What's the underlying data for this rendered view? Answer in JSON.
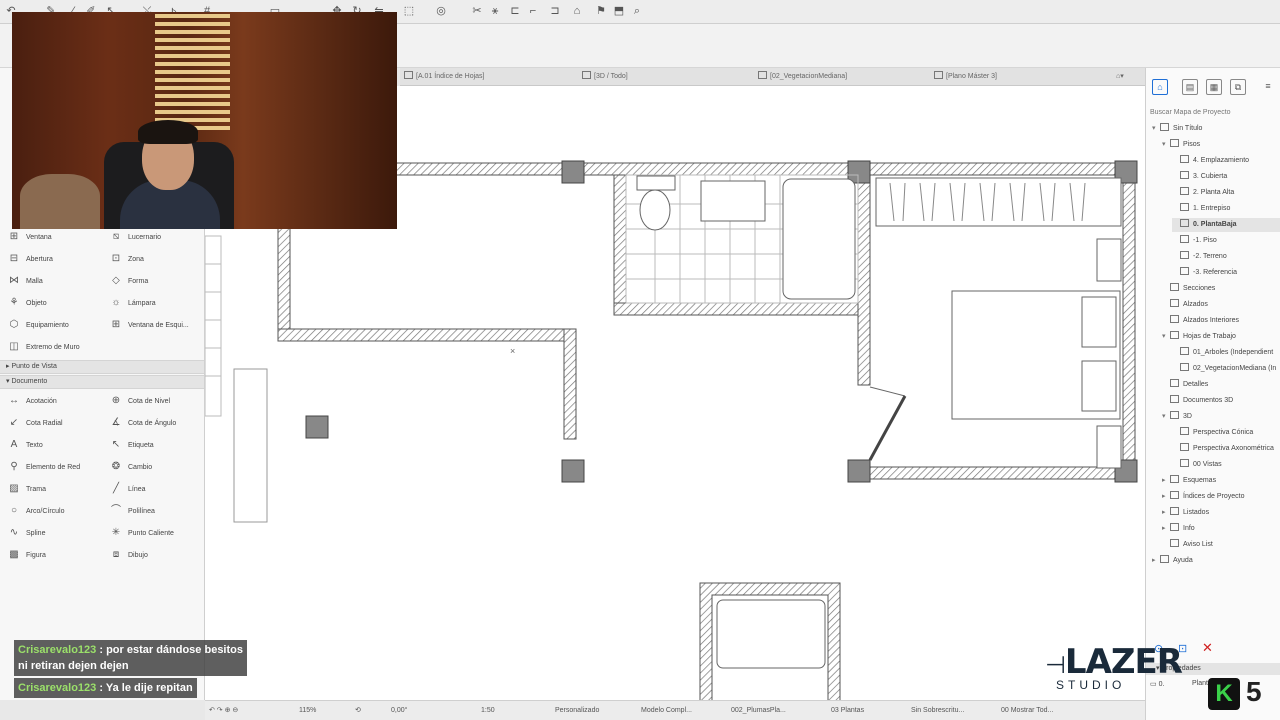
{
  "tabs": [
    {
      "label": "[A.01 Índice de Hojas]"
    },
    {
      "label": "[3D / Todo]"
    },
    {
      "label": "[02_VegetacionMediana]"
    },
    {
      "label": "[Plano Máster 3]"
    }
  ],
  "toolbox": {
    "tools_top": [
      {
        "label": "Ventana",
        "icon": "window-icon"
      },
      {
        "label": "Lucernario",
        "icon": "skylight-icon"
      },
      {
        "label": "Abertura",
        "icon": "opening-icon"
      },
      {
        "label": "Zona",
        "icon": "zone-icon"
      },
      {
        "label": "Malla",
        "icon": "mesh-icon"
      },
      {
        "label": "Forma",
        "icon": "morph-icon"
      },
      {
        "label": "Objeto",
        "icon": "object-icon"
      },
      {
        "label": "Lámpara",
        "icon": "lamp-icon"
      },
      {
        "label": "Equipamiento",
        "icon": "equipment-icon"
      },
      {
        "label": "Ventana de Esqui...",
        "icon": "corner-window-icon"
      },
      {
        "label": "Extremo de Muro",
        "icon": "wall-end-icon"
      }
    ],
    "section_view": "Punto de Vista",
    "section_doc": "Documento",
    "tools_doc": [
      {
        "label": "Acotación",
        "icon": "dimension-icon"
      },
      {
        "label": "Cota de Nivel",
        "icon": "level-dimension-icon"
      },
      {
        "label": "Cota Radial",
        "icon": "radial-dimension-icon"
      },
      {
        "label": "Cota de Ángulo",
        "icon": "angle-dimension-icon"
      },
      {
        "label": "Texto",
        "icon": "text-icon"
      },
      {
        "label": "Etiqueta",
        "icon": "label-icon"
      },
      {
        "label": "Elemento de Red",
        "icon": "grid-element-icon"
      },
      {
        "label": "Cambio",
        "icon": "change-icon"
      },
      {
        "label": "Trama",
        "icon": "fill-icon"
      },
      {
        "label": "Línea",
        "icon": "line-icon"
      },
      {
        "label": "Arco/Círculo",
        "icon": "arc-circle-icon"
      },
      {
        "label": "Polilínea",
        "icon": "polyline-icon"
      },
      {
        "label": "Spline",
        "icon": "spline-icon"
      },
      {
        "label": "Punto Caliente",
        "icon": "hotspot-icon"
      },
      {
        "label": "Figura",
        "icon": "figure-icon"
      },
      {
        "label": "Dibujo",
        "icon": "drawing-icon"
      }
    ]
  },
  "navigator": {
    "search_placeholder": "Buscar Mapa de Proyecto",
    "items": [
      {
        "label": "Sin Título",
        "level": 0,
        "caret": "v"
      },
      {
        "label": "Pisos",
        "level": 1,
        "caret": "v"
      },
      {
        "label": "4. Emplazamiento",
        "level": 2,
        "caret": ""
      },
      {
        "label": "3. Cubierta",
        "level": 2,
        "caret": ""
      },
      {
        "label": "2. Planta Alta",
        "level": 2,
        "caret": ""
      },
      {
        "label": "1. Entrepiso",
        "level": 2,
        "caret": ""
      },
      {
        "label": "0. PlantaBaja",
        "level": 2,
        "caret": "",
        "selected": true
      },
      {
        "label": "-1. Piso",
        "level": 2,
        "caret": ""
      },
      {
        "label": "-2. Terreno",
        "level": 2,
        "caret": ""
      },
      {
        "label": "-3. Referencia",
        "level": 2,
        "caret": ""
      },
      {
        "label": "Secciones",
        "level": 1,
        "caret": ""
      },
      {
        "label": "Alzados",
        "level": 1,
        "caret": ""
      },
      {
        "label": "Alzados Interiores",
        "level": 1,
        "caret": ""
      },
      {
        "label": "Hojas de Trabajo",
        "level": 1,
        "caret": "v"
      },
      {
        "label": "01_Arboles (Independient",
        "level": 2,
        "caret": ""
      },
      {
        "label": "02_VegetacionMediana (In",
        "level": 2,
        "caret": ""
      },
      {
        "label": "Detalles",
        "level": 1,
        "caret": ""
      },
      {
        "label": "Documentos 3D",
        "level": 1,
        "caret": ""
      },
      {
        "label": "3D",
        "level": 1,
        "caret": "v"
      },
      {
        "label": "Perspectiva Cónica",
        "level": 2,
        "caret": ""
      },
      {
        "label": "Perspectiva Axonométrica",
        "level": 2,
        "caret": ""
      },
      {
        "label": "00 Vistas",
        "level": 2,
        "caret": ""
      },
      {
        "label": "Esquemas",
        "level": 1,
        "caret": ">"
      },
      {
        "label": "Índices de Proyecto",
        "level": 1,
        "caret": ">"
      },
      {
        "label": "Listados",
        "level": 1,
        "caret": ">"
      },
      {
        "label": "Info",
        "level": 1,
        "caret": ">"
      },
      {
        "label": "Aviso List",
        "level": 1,
        "caret": ""
      },
      {
        "label": "Ayuda",
        "level": 0,
        "caret": ">"
      }
    ],
    "properties_label": "Propiedades",
    "props_value": "0.",
    "props_field": "Planta"
  },
  "statusbar": {
    "zoom": "115%",
    "angle": "0,00°",
    "scale": "1:50",
    "custom": "Personalizado",
    "model": "Modelo Compl...",
    "layer": "002_PlumasPla...",
    "plants": "03 Plantas",
    "override": "Sin Sobrescritu...",
    "show": "00 Mostrar Tod..."
  },
  "chat": [
    {
      "user": "Crisarevalo123",
      "sep": " : ",
      "msg": "por estar dándose besitos",
      "msg2": "ni retiran dejen dejen"
    },
    {
      "user": "Crisarevalo123",
      "sep": " : ",
      "msg": "Ya le dije repitan"
    }
  ],
  "logo": {
    "main": "LAZER",
    "sub": "STUDIO",
    "badge_number": "5"
  },
  "colors": {
    "accent": "#1f6fd6",
    "wall_hatch": "#8a8a8a",
    "chat_user": "#9be06a",
    "badge_green": "#3bd14a"
  }
}
